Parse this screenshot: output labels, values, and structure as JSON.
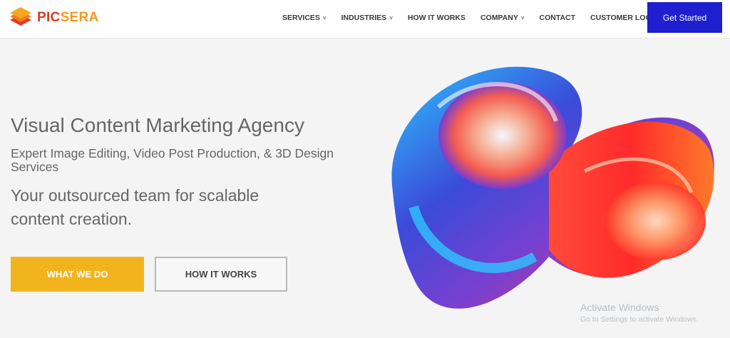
{
  "brand": {
    "part1": "PIC",
    "part2": "SERA",
    "colors": {
      "primary": "#d93a26",
      "accent": "#f29a1f"
    }
  },
  "nav": {
    "items": [
      {
        "label": "SERVICES",
        "has_dropdown": true
      },
      {
        "label": "INDUSTRIES",
        "has_dropdown": true
      },
      {
        "label": "HOW IT WORKS",
        "has_dropdown": false
      },
      {
        "label": "COMPANY",
        "has_dropdown": true
      },
      {
        "label": "CONTACT",
        "has_dropdown": false
      },
      {
        "label": "CUSTOMER LOGIN",
        "has_dropdown": false
      }
    ],
    "cta": "Get Started",
    "chevron": "˅"
  },
  "hero": {
    "title": "Visual Content Marketing Agency",
    "subtitle": "Expert Image Editing, Video Post Production, & 3D Design Services",
    "tagline": "Your outsourced team for scalable content creation.",
    "primary_button": "WHAT WE DO",
    "secondary_button": "HOW IT WORKS"
  },
  "watermark": {
    "title": "Activate Windows",
    "subtitle": "Go to Settings to activate Windows."
  },
  "colors": {
    "cta": "#1f1fcf",
    "primary_button": "#f2b41d",
    "background": "#f4f4f4"
  },
  "icons": {
    "logo": "layered-diamond-logo-icon",
    "dropdown": "chevron-down-icon",
    "hero_art": "abstract-3d-swirl"
  }
}
